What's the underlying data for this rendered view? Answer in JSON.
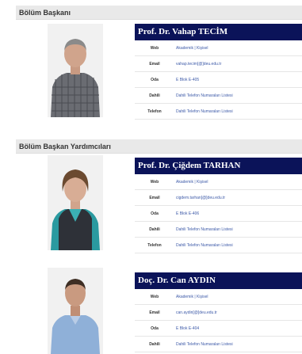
{
  "sections": {
    "head": {
      "title": "Bölüm Başkanı",
      "person": {
        "name": "Prof. Dr. Vahap TECİM",
        "web": "Akademik | Kişisel",
        "email": "vahap.tecim[@]deu.edu.tr",
        "room": "E Blok E-405",
        "ext": "Dahili Telefon Numaraları Listesi",
        "phone": "Dahili Telefon Numaraları Listesi"
      }
    },
    "deputies": {
      "title": "Bölüm Başkan Yardımcıları",
      "people": [
        {
          "name": "Prof. Dr. Çiğdem TARHAN",
          "web": "Akademik | Kişisel",
          "email": "cigdem.tarhan[@]deu.edu.tr",
          "room": "E Blok E-406",
          "ext": "Dahili Telefon Numaraları Listesi",
          "phone": "Dahili Telefon Numaraları Listesi"
        },
        {
          "name": "Doç. Dr. Can AYDIN",
          "web": "Akademik | Kişisel",
          "email": "can.aydin[@]deu.edu.tr",
          "room": "E Blok E-404",
          "ext": "Dahili Telefon Numaraları Listesi"
        }
      ]
    }
  },
  "labels": {
    "web": "Web",
    "email": "Email",
    "room": "Oda",
    "ext": "Dahili",
    "phone": "Telefon"
  },
  "colors": {
    "name_bar": "#0b1359",
    "link": "#3d5aa8",
    "header_bg": "#e9e9e9"
  }
}
